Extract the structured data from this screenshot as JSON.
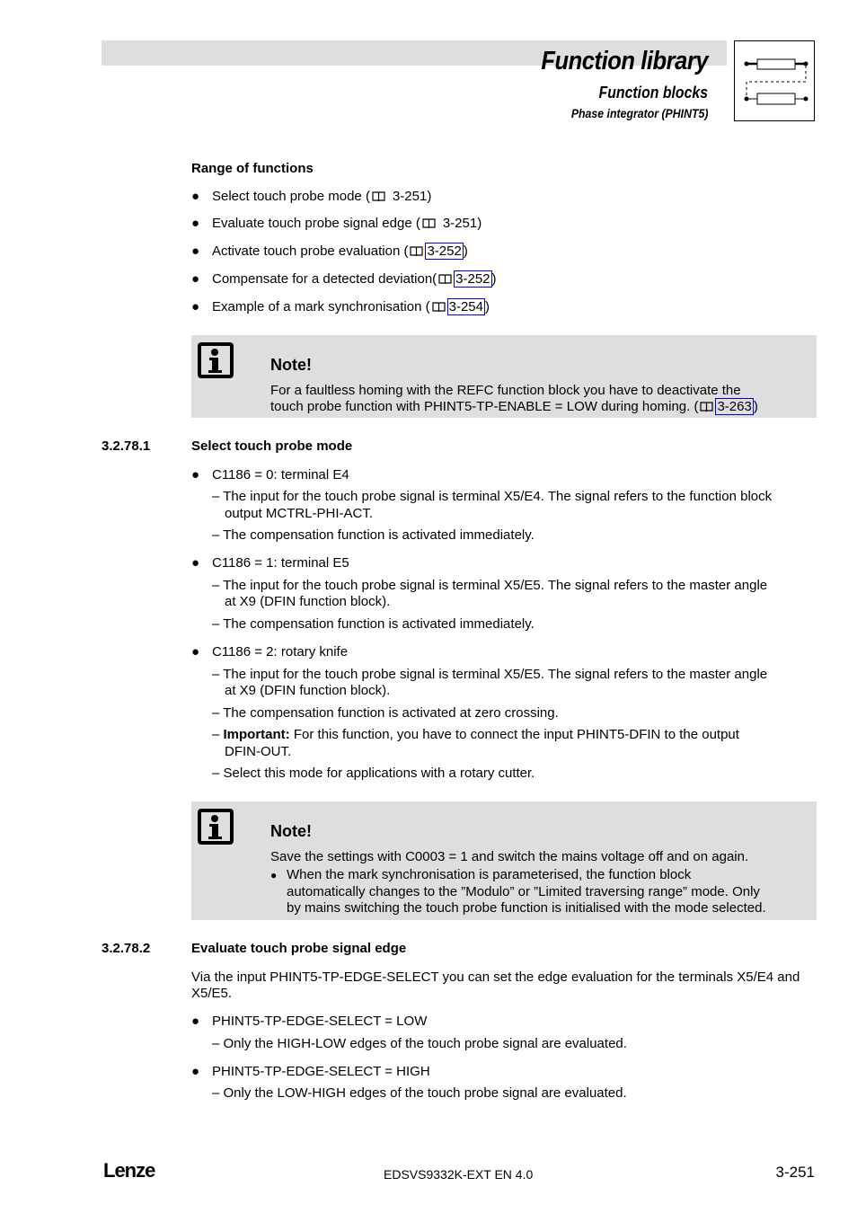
{
  "header": {
    "title": "Function library",
    "subtitle": "Function blocks",
    "section": "Phase integrator (PHINT5)",
    "logo_icon": "function-block-diagram-icon"
  },
  "range": {
    "heading": "Range of functions",
    "items": [
      {
        "text": "Select touch probe mode (",
        "ref": "3-251",
        "linked": false,
        "close": ")"
      },
      {
        "text": "Evaluate touch probe signal edge (",
        "ref": "3-251",
        "linked": false,
        "close": ")"
      },
      {
        "text": "Activate touch probe evaluation (",
        "ref": "3-252",
        "linked": true,
        "close": ")"
      },
      {
        "text": "Compensate for a detected deviation(",
        "ref": "3-252",
        "linked": true,
        "close": ")"
      },
      {
        "text": "Example of a mark synchronisation (",
        "ref": "3-254",
        "linked": true,
        "close": ")"
      }
    ]
  },
  "note1": {
    "title": "Note!",
    "line1": "For a faultless homing with the REFC function block you have to deactivate the",
    "line2": "touch probe function with PHINT5-TP-ENABLE = LOW during homing. (",
    "ref": "3-263",
    "close": ")"
  },
  "section1": {
    "number": "3.2.78.1",
    "heading": "Select touch probe mode",
    "b1": "C1186 = 0: terminal E4",
    "b1_d1_l1": "– The input for the touch probe signal is terminal X5/E4. The signal refers to the function block",
    "b1_d1_l2": "output MCTRL-PHI-ACT.",
    "b1_d2": "– The compensation function is activated immediately.",
    "b2": "C1186 = 1: terminal E5",
    "b2_d1_l1": "– The input for the touch probe signal is terminal X5/E5. The signal refers to the master angle",
    "b2_d1_l2": "at X9 (DFIN function block).",
    "b2_d2": "– The compensation function is activated immediately.",
    "b3": "C1186 = 2: rotary knife",
    "b3_d1_l1": "– The input for the touch probe signal is terminal X5/E5. The signal refers to the master angle",
    "b3_d1_l2": "at X9 (DFIN function block).",
    "b3_d2": "– The compensation function is activated at zero crossing.",
    "b3_d3_dash": "– ",
    "b3_d3_bold": "Important:",
    "b3_d3_l1": " For this function, you have to connect the input PHINT5-DFIN to the output",
    "b3_d3_l2": "DFIN-OUT.",
    "b3_d4": "– Select this mode for applications with a rotary cutter."
  },
  "note2": {
    "title": "Note!",
    "line1": "Save the settings with C0003 = 1 and switch the mains voltage off and on again.",
    "bullet_l1": "When the mark synchronisation is parameterised, the function block",
    "bullet_l2": "automatically changes to the ”Modulo” or ”Limited traversing range” mode. Only",
    "bullet_l3": "by mains switching the touch probe function is initialised with the mode selected."
  },
  "section2": {
    "number": "3.2.78.2",
    "heading": "Evaluate touch probe signal edge",
    "intro_l1": "Via the input PHINT5-TP-EDGE-SELECT you can set the edge evaluation for the terminals X5/E4 and",
    "intro_l2": "X5/E5.",
    "b1": "PHINT5-TP-EDGE-SELECT = LOW",
    "b1_d1": "– Only the HIGH-LOW edges of the touch probe signal are evaluated.",
    "b2": "PHINT5-TP-EDGE-SELECT = HIGH",
    "b2_d1": "– Only the LOW-HIGH edges of the touch probe signal are evaluated."
  },
  "footer": {
    "brand": "Lenze",
    "doc_id": "EDSVS9332K-EXT EN 4.0",
    "page": "3-251"
  },
  "colors": {
    "header_bar": "#dedede",
    "note_bg": "#dedede",
    "link_border": "#0000e0"
  }
}
